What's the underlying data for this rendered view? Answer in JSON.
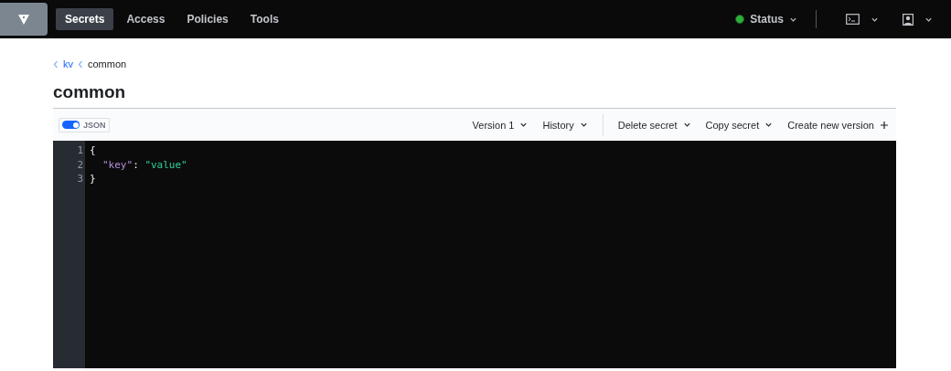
{
  "nav": {
    "items": [
      {
        "label": "Secrets",
        "selected": true
      },
      {
        "label": "Access",
        "selected": false
      },
      {
        "label": "Policies",
        "selected": false
      },
      {
        "label": "Tools",
        "selected": false
      }
    ],
    "status": {
      "label": "Status",
      "color": "#2eb039"
    }
  },
  "breadcrumbs": [
    "kv",
    "common"
  ],
  "title": "common",
  "toolbar": {
    "json_toggle": {
      "label": "JSON",
      "on": true
    },
    "actions": [
      {
        "label": "Version 1",
        "kind": "dropdown"
      },
      {
        "label": "History",
        "kind": "dropdown"
      },
      {
        "label": "Delete secret",
        "kind": "dropdown"
      },
      {
        "label": "Copy secret",
        "kind": "dropdown"
      },
      {
        "label": "Create new version",
        "kind": "add"
      }
    ]
  },
  "editor": {
    "lines": [
      {
        "number": "1",
        "indented": false,
        "tokens": [
          {
            "text": "{",
            "kind": "punct"
          }
        ]
      },
      {
        "number": "2",
        "indented": true,
        "tokens": [
          {
            "text": "\"key\"",
            "kind": "key"
          },
          {
            "text": ": ",
            "kind": "punct"
          },
          {
            "text": "\"value\"",
            "kind": "string"
          }
        ]
      },
      {
        "number": "3",
        "indented": false,
        "tokens": [
          {
            "text": "}",
            "kind": "punct"
          }
        ]
      }
    ]
  }
}
